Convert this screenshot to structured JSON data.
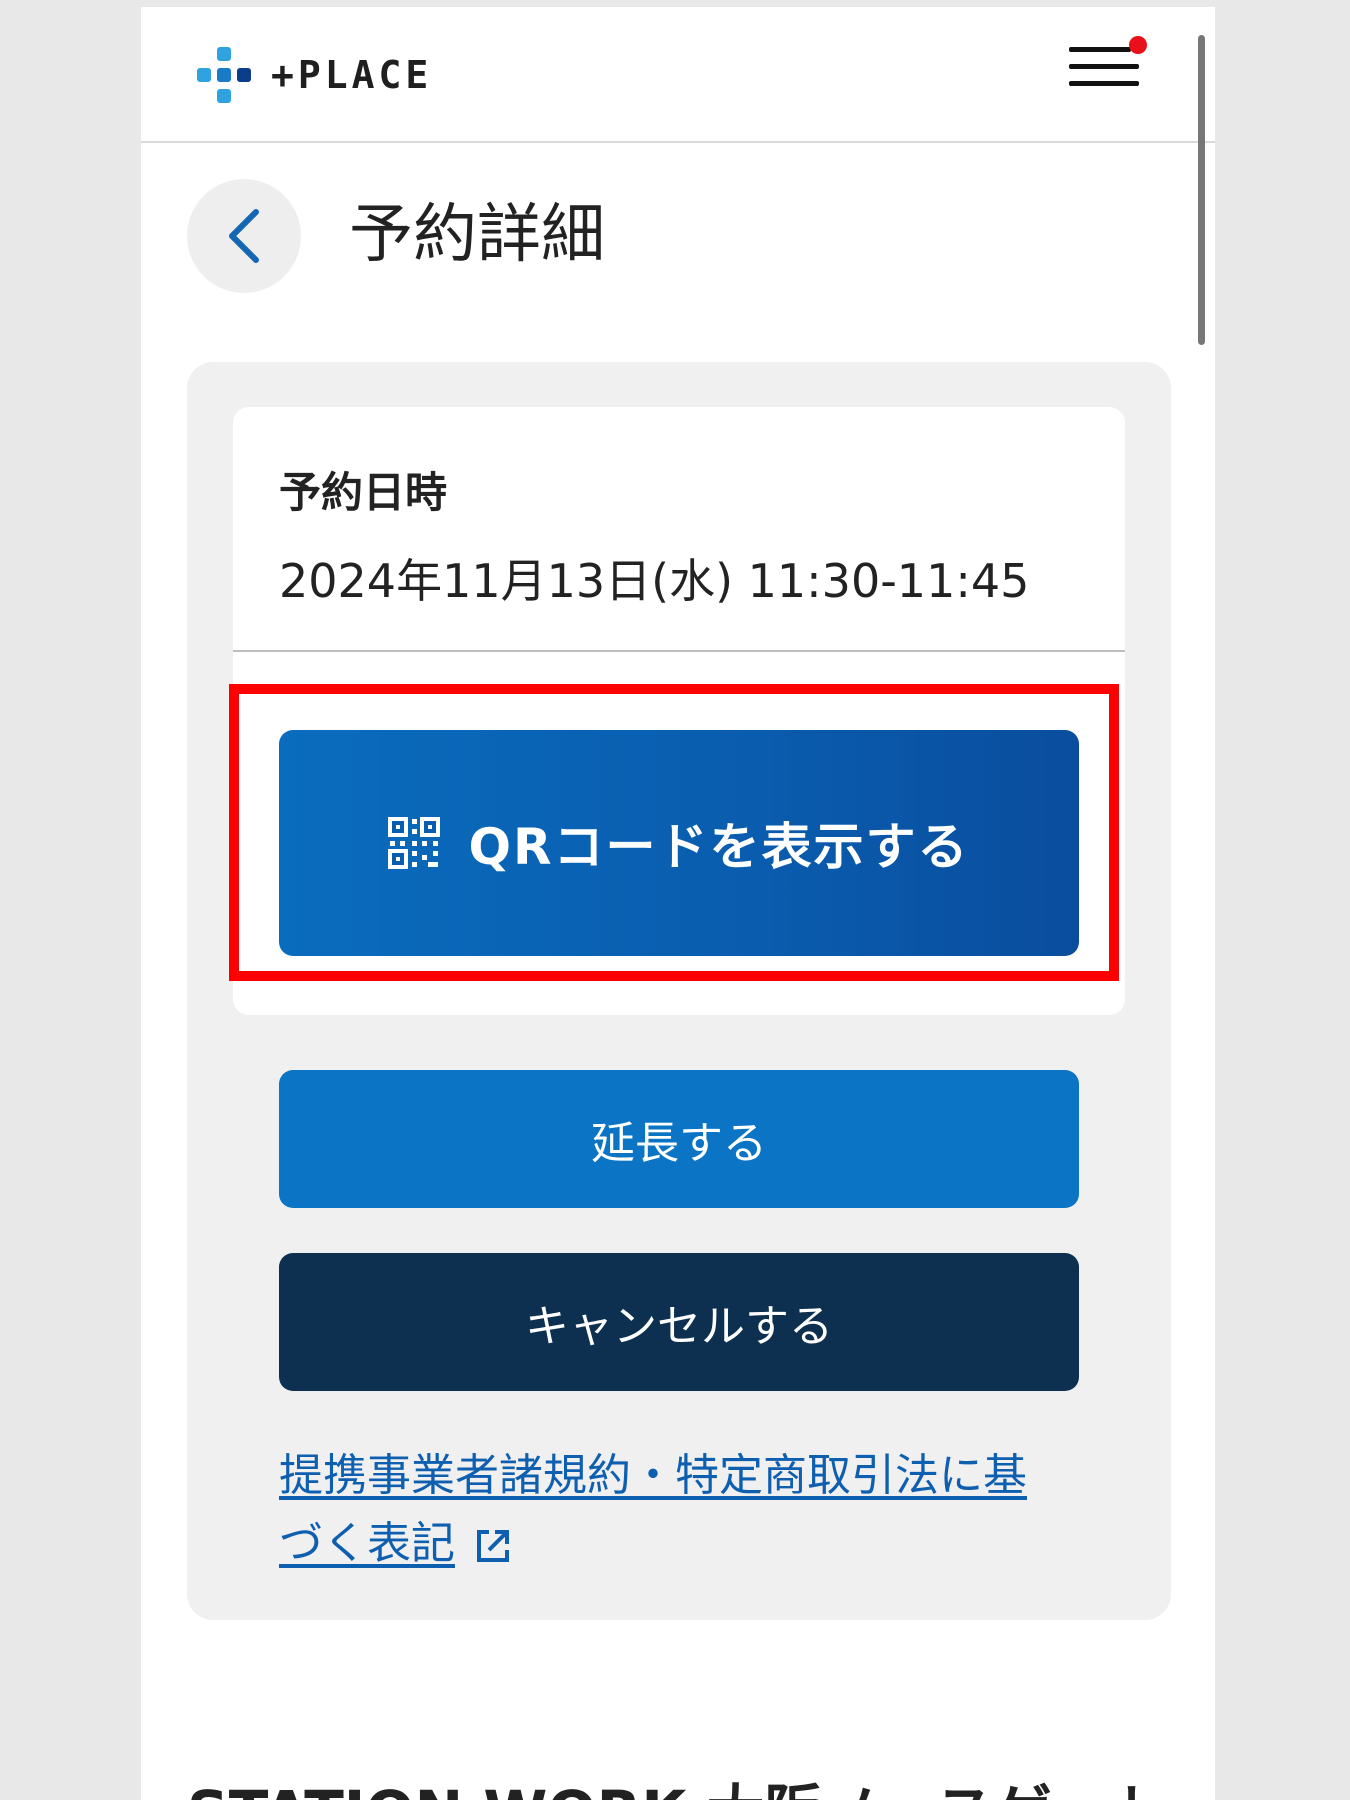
{
  "brand": {
    "name": "+PLACE",
    "colors": {
      "light_blue": "#2fa3e0",
      "mid_blue": "#1a7cc8",
      "dark_blue": "#0b3d8a"
    }
  },
  "header": {
    "menu_icon": "hamburger-menu-icon",
    "notification_dot_color": "#e8101a"
  },
  "page": {
    "back_icon": "chevron-left-icon",
    "title": "予約詳細"
  },
  "reservation": {
    "datetime_label": "予約日時",
    "datetime_value": "2024年11月13日(水) 11:30-11:45"
  },
  "actions": {
    "qr_icon": "qr-code-icon",
    "show_qr_label": "QRコードを表示する",
    "extend_label": "延長する",
    "cancel_label": "キャンセルする",
    "highlight_color": "#ff0000"
  },
  "legal": {
    "link_text": "提携事業者諸規約・特定商取引法に基づく表記",
    "link_icon": "external-link-icon"
  },
  "location": {
    "title_partial": "STATION WORK 大阪ノースゲート"
  }
}
